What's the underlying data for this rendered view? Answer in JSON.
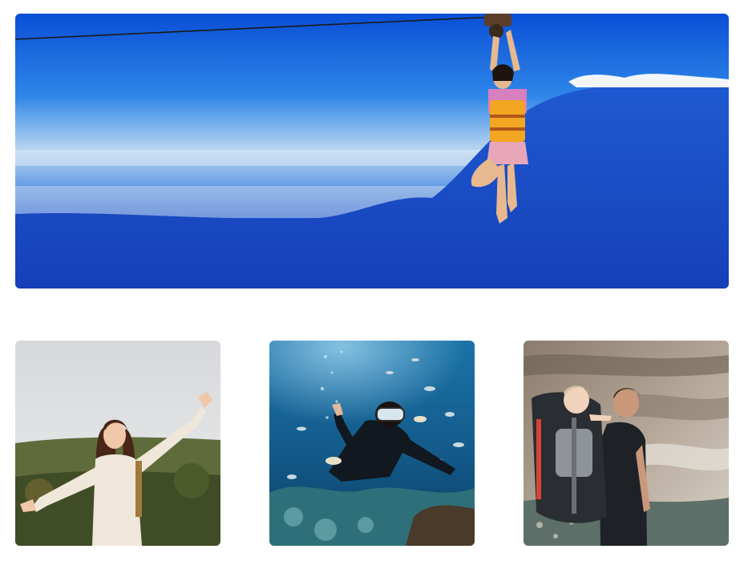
{
  "gallery": {
    "hero": {
      "subject": "zipline-above-clouds",
      "colors": {
        "sky_top": "#0a4fd6",
        "sky_mid": "#2f86e8",
        "horizon": "#cfe3f4",
        "cloud_deep": "#1a4bc6",
        "life_vest": "#f2a621",
        "shirt": "#d77fbf"
      }
    },
    "tiles": [
      {
        "subject": "woman-celebrating-outdoors",
        "colors": {
          "sky": "#dfe0e2",
          "forest": "#4d5a2c",
          "sweater": "#efe7d9",
          "hair": "#4a2616"
        }
      },
      {
        "subject": "scuba-diver-with-fish",
        "colors": {
          "water_top": "#1b73a8",
          "water_bottom": "#0b3e62",
          "reef": "#2f6f7a",
          "wetsuit": "#111820"
        }
      },
      {
        "subject": "hiker-with-baby-carrier",
        "colors": {
          "rock": "#9c8c7c",
          "rock_light": "#d7d1c8",
          "pack": "#2a2d31",
          "shirt": "#1e2226"
        }
      }
    ]
  }
}
